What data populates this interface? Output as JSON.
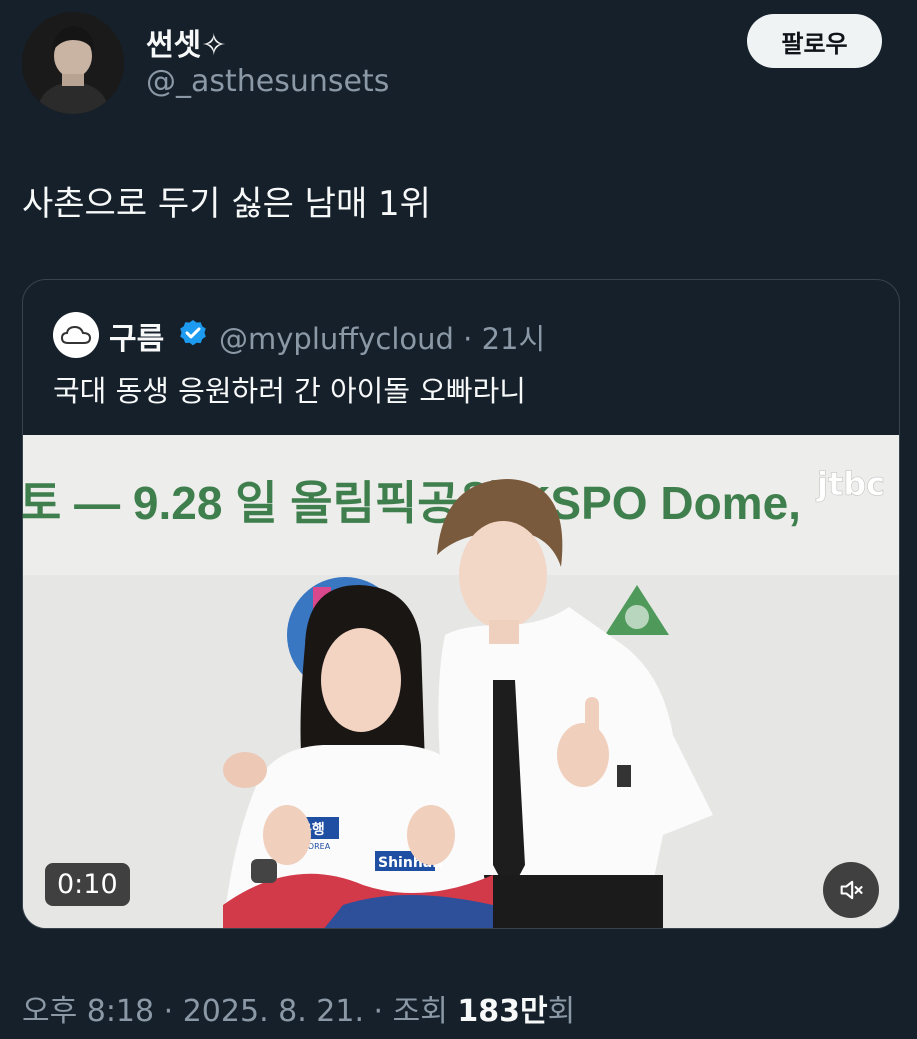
{
  "author": {
    "display_name": "썬셋✧",
    "handle": "@_asthesunsets",
    "avatar_icon": "profile-photo"
  },
  "follow_button": {
    "label": "팔로우"
  },
  "tweet": {
    "text": "사촌으로 두기 싫은 남매 1위"
  },
  "quote": {
    "display_name": "구름",
    "verified_icon": "verified-badge-icon",
    "handle": "@mypluffycloud",
    "separator": " · ",
    "time": "21시",
    "text": "국대 동생 응원하러 간 아이돌 오빠라니",
    "avatar_icon": "cloud-icon"
  },
  "media": {
    "duration": "0:10",
    "mute_icon": "mute-icon",
    "banner_text": "토 — 9.28 일   올림픽공원(KSPO Dome,",
    "watermark": "jtbc",
    "jersey_text": "Shinhan",
    "jersey_text2": "은행",
    "jersey_text3": "KOREA"
  },
  "footer": {
    "time": "오후 8:18",
    "sep1": " · ",
    "date": "2025. 8. 21.",
    "sep2": " · ",
    "views_label": "조회 ",
    "views_count": "183만",
    "views_suffix": "회"
  },
  "colors": {
    "background": "#15202b",
    "text_primary": "#f7f9f9",
    "text_secondary": "#8b98a5",
    "verified_blue": "#1d9bf0",
    "border": "#38444d"
  }
}
